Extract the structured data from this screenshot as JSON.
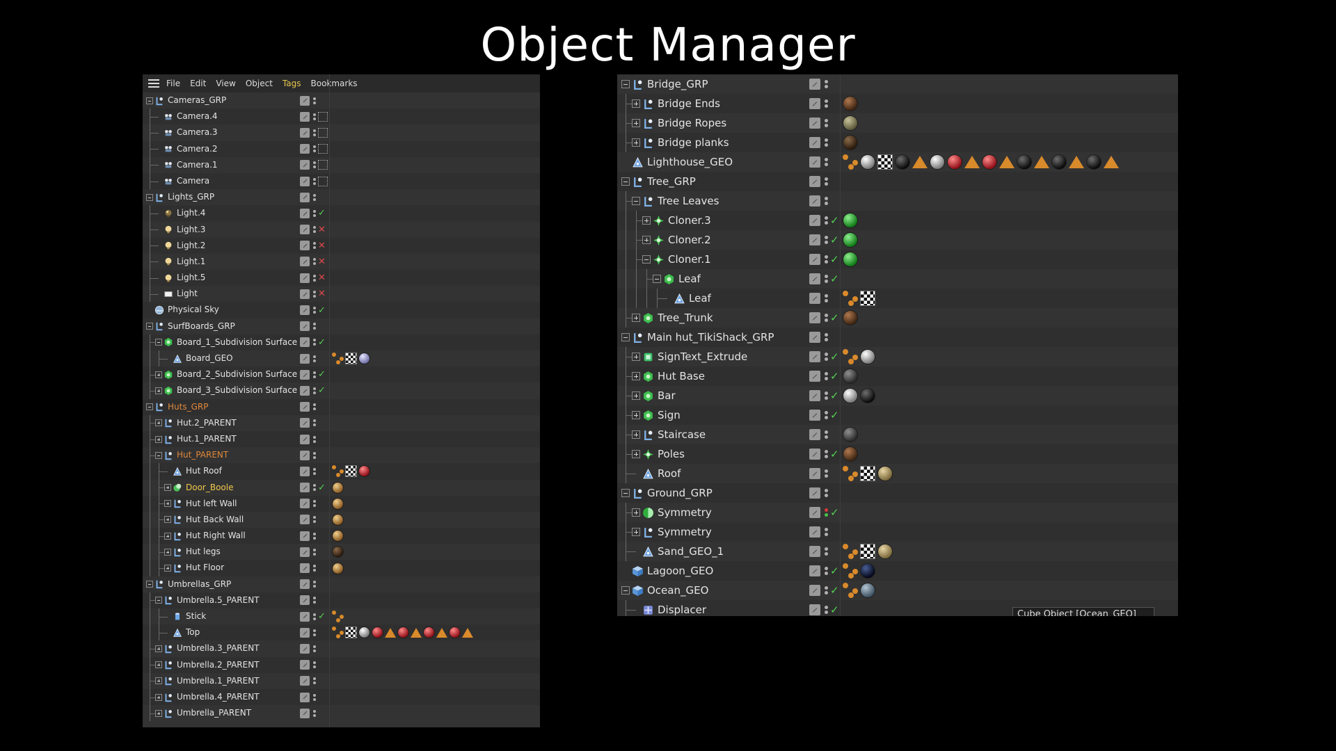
{
  "slide_title": "Object Manager",
  "left_panel": {
    "menu": [
      "File",
      "Edit",
      "View",
      "Object",
      "Tags",
      "Bookmarks"
    ],
    "active_menu": "Tags",
    "rows": [
      {
        "name": "Cameras_GRP",
        "depth": 0,
        "icon": "null",
        "expander": "minus",
        "status": "none",
        "tags": []
      },
      {
        "name": "Camera.4",
        "depth": 1,
        "icon": "camera",
        "status": "box",
        "tags": []
      },
      {
        "name": "Camera.3",
        "depth": 1,
        "icon": "camera",
        "status": "box",
        "tags": []
      },
      {
        "name": "Camera.2",
        "depth": 1,
        "icon": "camera",
        "status": "box",
        "tags": []
      },
      {
        "name": "Camera.1",
        "depth": 1,
        "icon": "camera",
        "status": "box",
        "tags": []
      },
      {
        "name": "Camera",
        "depth": 1,
        "icon": "camera",
        "status": "box",
        "tags": []
      },
      {
        "name": "Lights_GRP",
        "depth": 0,
        "icon": "null",
        "expander": "minus",
        "status": "none",
        "tags": []
      },
      {
        "name": "Light.4",
        "depth": 1,
        "icon": "light-dark",
        "status": "check",
        "tags": []
      },
      {
        "name": "Light.3",
        "depth": 1,
        "icon": "light",
        "status": "cross",
        "tags": []
      },
      {
        "name": "Light.2",
        "depth": 1,
        "icon": "light",
        "status": "cross",
        "tags": []
      },
      {
        "name": "Light.1",
        "depth": 1,
        "icon": "light",
        "status": "cross",
        "tags": []
      },
      {
        "name": "Light.5",
        "depth": 1,
        "icon": "light",
        "status": "cross",
        "tags": []
      },
      {
        "name": "Light",
        "depth": 1,
        "icon": "area-light",
        "status": "cross",
        "tags": []
      },
      {
        "name": "Physical Sky",
        "depth": 0,
        "icon": "sky",
        "status": "check",
        "tags": []
      },
      {
        "name": "SurfBoards_GRP",
        "depth": 0,
        "icon": "null",
        "expander": "minus",
        "status": "none",
        "tags": []
      },
      {
        "name": "Board_1_Subdivision Surface",
        "depth": 1,
        "icon": "subdiv",
        "expander": "minus",
        "status": "check",
        "tags": []
      },
      {
        "name": "Board_GEO",
        "depth": 2,
        "icon": "poly",
        "status": "none",
        "tags": [
          "uv",
          "checker",
          "lavender"
        ]
      },
      {
        "name": "Board_2_Subdivision Surface",
        "depth": 1,
        "icon": "subdiv",
        "expander": "plus",
        "status": "check",
        "tags": []
      },
      {
        "name": "Board_3_Subdivision Surface",
        "depth": 1,
        "icon": "subdiv",
        "expander": "plus",
        "status": "check",
        "tags": []
      },
      {
        "name": "Huts_GRP",
        "depth": 0,
        "icon": "null",
        "expander": "minus",
        "status": "none",
        "tags": [],
        "color": "orange"
      },
      {
        "name": "Hut.2_PARENT",
        "depth": 1,
        "icon": "null",
        "expander": "plus",
        "status": "none",
        "tags": []
      },
      {
        "name": "Hut.1_PARENT",
        "depth": 1,
        "icon": "null",
        "expander": "plus",
        "status": "none",
        "tags": []
      },
      {
        "name": "Hut_PARENT",
        "depth": 1,
        "icon": "null",
        "expander": "minus",
        "status": "none",
        "tags": [],
        "color": "orange"
      },
      {
        "name": "Hut Roof",
        "depth": 2,
        "icon": "poly",
        "status": "none",
        "tags": [
          "uv",
          "checker",
          "red"
        ]
      },
      {
        "name": "Door_Boole",
        "depth": 2,
        "icon": "boole",
        "expander": "plus",
        "status": "check",
        "tags": [
          "wood"
        ],
        "color": "yellow"
      },
      {
        "name": "Hut left Wall",
        "depth": 2,
        "icon": "null",
        "expander": "plus",
        "status": "none",
        "tags": [
          "wood"
        ]
      },
      {
        "name": "Hut Back Wall",
        "depth": 2,
        "icon": "null",
        "expander": "plus",
        "status": "none",
        "tags": [
          "wood"
        ]
      },
      {
        "name": "Hut Right Wall",
        "depth": 2,
        "icon": "null",
        "expander": "plus",
        "status": "none",
        "tags": [
          "wood"
        ]
      },
      {
        "name": "Hut legs",
        "depth": 2,
        "icon": "null",
        "expander": "plus",
        "status": "none",
        "tags": [
          "darkwood"
        ]
      },
      {
        "name": "Hut Floor",
        "depth": 2,
        "icon": "null",
        "expander": "plus",
        "status": "none",
        "tags": [
          "wood"
        ]
      },
      {
        "name": "Umbrellas_GRP",
        "depth": 0,
        "icon": "null",
        "expander": "minus",
        "status": "none",
        "tags": []
      },
      {
        "name": "Umbrella.5_PARENT",
        "depth": 1,
        "icon": "null",
        "expander": "minus",
        "status": "none",
        "tags": []
      },
      {
        "name": "Stick",
        "depth": 2,
        "icon": "cylinder",
        "status": "check",
        "tags": [
          "uv"
        ]
      },
      {
        "name": "Top",
        "depth": 2,
        "icon": "poly",
        "status": "none",
        "tags": [
          "uv",
          "checker",
          "white",
          "red",
          "tri",
          "red",
          "tri",
          "red",
          "tri",
          "red",
          "tri"
        ]
      },
      {
        "name": "Umbrella.3_PARENT",
        "depth": 1,
        "icon": "null",
        "expander": "plus",
        "status": "none",
        "tags": []
      },
      {
        "name": "Umbrella.2_PARENT",
        "depth": 1,
        "icon": "null",
        "expander": "plus",
        "status": "none",
        "tags": []
      },
      {
        "name": "Umbrella.1_PARENT",
        "depth": 1,
        "icon": "null",
        "expander": "plus",
        "status": "none",
        "tags": []
      },
      {
        "name": "Umbrella.4_PARENT",
        "depth": 1,
        "icon": "null",
        "expander": "plus",
        "status": "none",
        "tags": []
      },
      {
        "name": "Umbrella_PARENT",
        "depth": 1,
        "icon": "null",
        "expander": "plus",
        "status": "none",
        "tags": []
      }
    ]
  },
  "right_panel": {
    "rows": [
      {
        "name": "Bridge_GRP",
        "depth": 0,
        "icon": "null",
        "expander": "minus",
        "status": "none",
        "tags": []
      },
      {
        "name": "Bridge Ends",
        "depth": 1,
        "icon": "null",
        "expander": "plus",
        "status": "none",
        "tags": [
          "brownwood"
        ]
      },
      {
        "name": "Bridge Ropes",
        "depth": 1,
        "icon": "null",
        "expander": "plus",
        "status": "none",
        "tags": [
          "olive"
        ]
      },
      {
        "name": "Bridge planks",
        "depth": 1,
        "icon": "null",
        "expander": "plus",
        "status": "none",
        "tags": [
          "darkwood"
        ]
      },
      {
        "name": "Lighthouse_GEO",
        "depth": 0,
        "icon": "poly",
        "status": "none",
        "tags": [
          "uv",
          "white",
          "checker",
          "black",
          "tri",
          "white",
          "red",
          "tri",
          "red",
          "tri",
          "black",
          "tri",
          "black",
          "tri",
          "black",
          "tri"
        ]
      },
      {
        "name": "Tree_GRP",
        "depth": 0,
        "icon": "null",
        "expander": "minus",
        "status": "none",
        "tags": []
      },
      {
        "name": "Tree Leaves",
        "depth": 1,
        "icon": "null",
        "expander": "minus",
        "status": "none",
        "tags": []
      },
      {
        "name": "Cloner.3",
        "depth": 2,
        "icon": "cloner",
        "expander": "plus",
        "status": "check",
        "tags": [
          "green"
        ]
      },
      {
        "name": "Cloner.2",
        "depth": 2,
        "icon": "cloner",
        "expander": "plus",
        "status": "check",
        "tags": [
          "green"
        ]
      },
      {
        "name": "Cloner.1",
        "depth": 2,
        "icon": "cloner",
        "expander": "minus",
        "status": "check",
        "tags": [
          "green"
        ]
      },
      {
        "name": "Leaf",
        "depth": 3,
        "icon": "subdiv",
        "expander": "minus",
        "status": "check",
        "tags": []
      },
      {
        "name": "Leaf",
        "depth": 4,
        "icon": "poly",
        "status": "none",
        "tags": [
          "uv",
          "checker"
        ]
      },
      {
        "name": "Tree_Trunk",
        "depth": 1,
        "icon": "subdiv",
        "expander": "plus",
        "status": "check",
        "tags": [
          "brownwood"
        ]
      },
      {
        "name": "Main hut_TikiShack_GRP",
        "depth": 0,
        "icon": "null",
        "expander": "minus",
        "status": "none",
        "tags": []
      },
      {
        "name": "SignText_Extrude",
        "depth": 1,
        "icon": "extrude",
        "expander": "plus",
        "status": "check",
        "tags": [
          "uv",
          "white"
        ]
      },
      {
        "name": "Hut Base",
        "depth": 1,
        "icon": "subdiv",
        "expander": "plus",
        "status": "check",
        "tags": [
          "darkgray"
        ]
      },
      {
        "name": "Bar",
        "depth": 1,
        "icon": "subdiv",
        "expander": "plus",
        "status": "check",
        "tags": [
          "white",
          "black"
        ]
      },
      {
        "name": "Sign",
        "depth": 1,
        "icon": "subdiv",
        "expander": "plus",
        "status": "check",
        "tags": []
      },
      {
        "name": "Staircase",
        "depth": 1,
        "icon": "null",
        "expander": "plus",
        "status": "none",
        "tags": [
          "darkgray"
        ]
      },
      {
        "name": "Poles",
        "depth": 1,
        "icon": "cloner",
        "expander": "plus",
        "status": "check",
        "tags": [
          "brownwood"
        ]
      },
      {
        "name": "Roof",
        "depth": 1,
        "icon": "poly",
        "status": "none",
        "tags": [
          "uv",
          "checker",
          "sand"
        ]
      },
      {
        "name": "Ground_GRP",
        "depth": 0,
        "icon": "null",
        "expander": "minus",
        "status": "none",
        "tags": []
      },
      {
        "name": "Symmetry",
        "depth": 1,
        "icon": "symmetry",
        "expander": "plus",
        "status": "check-red",
        "tags": []
      },
      {
        "name": "Symmetry",
        "depth": 1,
        "icon": "null",
        "expander": "plus",
        "status": "none",
        "tags": []
      },
      {
        "name": "Sand_GEO_1",
        "depth": 1,
        "icon": "poly",
        "status": "none",
        "tags": [
          "uv",
          "checker",
          "sand"
        ]
      },
      {
        "name": "Lagoon_GEO",
        "depth": 0,
        "icon": "cube",
        "status": "check",
        "tags": [
          "uv",
          "navy"
        ]
      },
      {
        "name": "Ocean_GEO",
        "depth": 0,
        "icon": "cube",
        "expander": "minus",
        "status": "check",
        "tags": [
          "uv",
          "steel"
        ]
      },
      {
        "name": "Displacer",
        "depth": 1,
        "icon": "displacer",
        "status": "check",
        "tags": []
      }
    ],
    "tooltip": "Cube Object [Ocean_GEO]"
  },
  "colors": {
    "background": "#000000",
    "panel": "#333333",
    "row_alt": "#2f2f2f",
    "active_menu": "#e6c64c",
    "orange_label": "#e0883a",
    "yellow_label": "#f2c84b",
    "check": "#52d152",
    "cross": "#e04848"
  }
}
